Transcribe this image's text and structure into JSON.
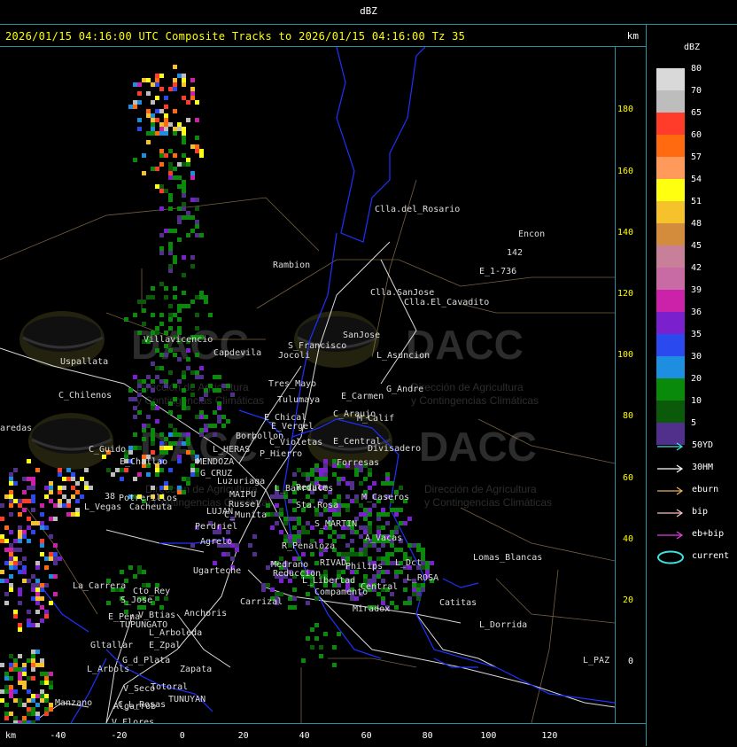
{
  "window": {
    "title": "dBZ"
  },
  "header": {
    "title": "2026/01/15 04:16:00 UTC Composite Tracks to 2026/01/15 04:16:00 Tz 35",
    "unit": "km"
  },
  "axes": {
    "x_label": "km",
    "x_ticks": [
      "-40",
      "-20",
      "0",
      "20",
      "40",
      "60",
      "80",
      "100",
      "120"
    ],
    "y_ticks": [
      "180",
      "160",
      "140",
      "120",
      "100",
      "80",
      "60",
      "40",
      "20",
      "0"
    ]
  },
  "legend": {
    "title": "dBZ",
    "levels": [
      {
        "label": "80",
        "color": "#d9d9d9"
      },
      {
        "label": "70",
        "color": "#bdbdbd"
      },
      {
        "label": "65",
        "color": "#ff3b2a"
      },
      {
        "label": "60",
        "color": "#ff6a10"
      },
      {
        "label": "57",
        "color": "#ff9a5a"
      },
      {
        "label": "54",
        "color": "#ffff10"
      },
      {
        "label": "51",
        "color": "#f6c22c"
      },
      {
        "label": "48",
        "color": "#d28c3c"
      },
      {
        "label": "45",
        "color": "#c8809a"
      },
      {
        "label": "42",
        "color": "#c86aa4"
      },
      {
        "label": "39",
        "color": "#cc22aa"
      },
      {
        "label": "36",
        "color": "#7a20cc"
      },
      {
        "label": "35",
        "color": "#2a4af0"
      },
      {
        "label": "30",
        "color": "#1e8ee0"
      },
      {
        "label": "20",
        "color": "#0a8a0a"
      },
      {
        "label": "10",
        "color": "#0a5a0a"
      },
      {
        "label": "5",
        "color": "#50308a"
      }
    ],
    "tracks": [
      {
        "label": "50YD",
        "color": "#40e0e0",
        "icon": "arrow-right-icon"
      },
      {
        "label": "30HM",
        "color": "#ffffff",
        "icon": "arrow-right-icon"
      },
      {
        "label": "eburn",
        "color": "#e8b060",
        "icon": "arrow-right-icon"
      },
      {
        "label": "bip",
        "color": "#ffc0c0",
        "icon": "arrow-right-icon"
      },
      {
        "label": "eb+bip",
        "color": "#e040e0",
        "icon": "arrow-right-icon"
      },
      {
        "label": "current",
        "color": "#40e0e0",
        "icon": "ellipse-icon"
      }
    ]
  },
  "map": {
    "watermark": {
      "brand": "DACC",
      "line1": "Dirección de Agricultura",
      "line2": "y Contingencias Climáticas"
    },
    "places": [
      "Clla.del_Rosario",
      "Encon",
      "142",
      "E_1-736",
      "Rambion",
      "Clla.SanJose",
      "Clla.El_Cavadito",
      "Villavicencio",
      "Capdevila",
      "S_Francisco",
      "Jocoli",
      "SanJose",
      "L_Asuncion",
      "Uspallata",
      "Tres_Mayo",
      "G_Andre",
      "C_Chilenos",
      "Tulumaya",
      "E_Carmen",
      "E_Chical",
      "C_Araujo",
      "M_Calif",
      "E_Vergel",
      "Borbollon",
      "C_Violetas",
      "E_Central",
      "Divisadero",
      "C_Guido",
      "L_HERAS",
      "P_Hierro",
      "Forresas",
      "E_Challao",
      "MENDOZA",
      "G_CRUZ",
      "Luzuriaga",
      "L_Barriales",
      "Reducm",
      "Potrerillos",
      "MAIPU",
      "Russel",
      "Sta.Rosa",
      "M_Caseros",
      "L_Vegas",
      "Cacheuta",
      "LUJAN",
      "C_Munita",
      "Perdriel",
      "S_MARTIN",
      "A_Vacas",
      "Agrelo",
      "R_Penaloza",
      "Lomas_Blancas",
      "Ugarteche",
      "Medrano",
      "RIVAD",
      "Philips",
      "L_Dct",
      "Reduccion",
      "L_Libertad",
      "La_Carrera",
      "Cto_Rey",
      "S_Jose",
      "Central",
      "L_ROSA",
      "Carrizal",
      "Catitas",
      "Compamento",
      "Miradox",
      "E_Pena",
      "V_Btias",
      "Anchoris",
      "TUPUNGATO",
      "L_Arboleda",
      "L_Dorrida",
      "Gltallar",
      "E_Zpal",
      "L_Arbols",
      "G_d_Plata",
      "Zapata",
      "L_PAZ",
      "V_Seco",
      "Totoral",
      "TUNUYAN",
      "Manzano",
      "C_L_Rosas",
      "V_Flores",
      "Algarrob",
      "aredas",
      "38"
    ]
  }
}
